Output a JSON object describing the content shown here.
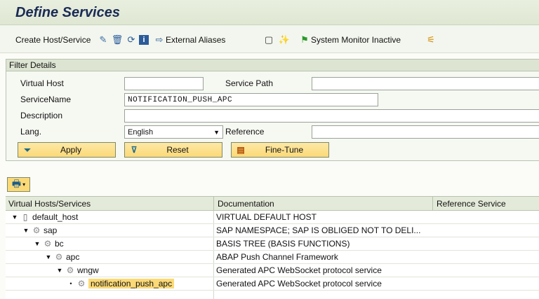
{
  "title": "Define Services",
  "toolbar": {
    "create_label": "Create Host/Service",
    "external_aliases_label": "External Aliases",
    "system_monitor_label": "System Monitor Inactive"
  },
  "filter": {
    "header": "Filter Details",
    "virtual_host_label": "Virtual Host",
    "virtual_host_value": "",
    "service_path_label": "Service Path",
    "service_path_value": "",
    "service_name_label": "ServiceName",
    "service_name_value": "NOTIFICATION_PUSH_APC",
    "description_label": "Description",
    "description_value": "",
    "lang_label": "Lang.",
    "lang_value": "English",
    "reference_label": "Reference",
    "reference_value": "",
    "apply_label": "Apply",
    "reset_label": "Reset",
    "finetune_label": "Fine-Tune"
  },
  "tree": {
    "columns": [
      "Virtual Hosts/Services",
      "Documentation",
      "Reference Service"
    ],
    "rows": [
      {
        "name": "default_host",
        "doc": "VIRTUAL DEFAULT HOST"
      },
      {
        "name": "sap",
        "doc": "SAP NAMESPACE; SAP IS OBLIGED NOT TO DELI..."
      },
      {
        "name": "bc",
        "doc": "BASIS TREE (BASIS FUNCTIONS)"
      },
      {
        "name": "apc",
        "doc": "ABAP Push Channel Framework"
      },
      {
        "name": "wngw",
        "doc": "Generated APC WebSocket protocol service"
      },
      {
        "name": "notification_push_apc",
        "doc": "Generated APC WebSocket protocol service"
      }
    ]
  },
  "colors": {
    "title": "#1a2a55",
    "button": "#fbd977",
    "header_bg": "#dde5d2"
  }
}
